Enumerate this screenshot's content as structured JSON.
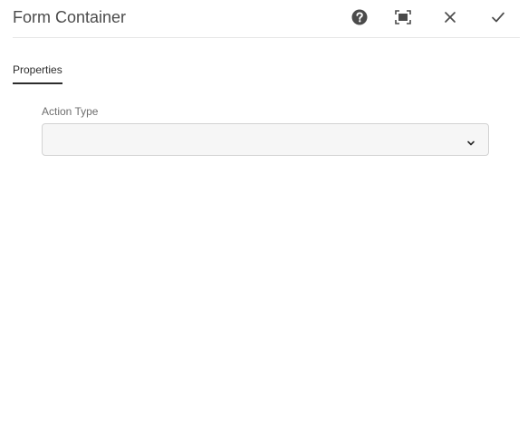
{
  "dialog": {
    "title": "Form Container",
    "actions": [
      {
        "name": "help",
        "icon": "help-icon"
      },
      {
        "name": "fullscreen",
        "icon": "fullscreen-icon"
      },
      {
        "name": "close",
        "icon": "close-icon"
      },
      {
        "name": "done",
        "icon": "checkmark-icon"
      }
    ]
  },
  "tabs": [
    {
      "label": "Properties",
      "selected": true
    }
  ],
  "fields": {
    "action_type": {
      "label": "Action Type",
      "value": "",
      "icon": "chevron-down-icon"
    }
  },
  "colors": {
    "text": "#4b4b4b",
    "tab_active": "#2c2c2c",
    "field_background": "#f6f6f6",
    "field_border": "#d3d3d3"
  }
}
